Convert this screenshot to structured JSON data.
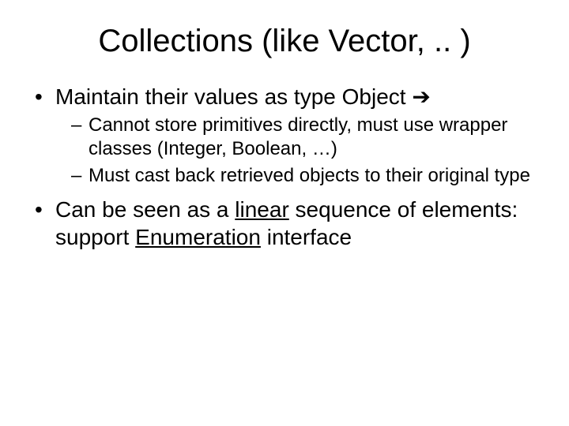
{
  "title": "Collections (like Vector, .. )",
  "bullets": {
    "b1_pre": "Maintain their values as type Object ",
    "b1_arrow": "➔",
    "b1_sub1": "Cannot store primitives directly, must use wrapper classes (Integer, Boolean, …)",
    "b1_sub2": "Must cast back retrieved objects to their original type",
    "b2_pre": "Can be seen as a ",
    "b2_linear": "linear",
    "b2_mid": " sequence of elements: support ",
    "b2_enum": "Enumeration",
    "b2_post": " interface"
  }
}
